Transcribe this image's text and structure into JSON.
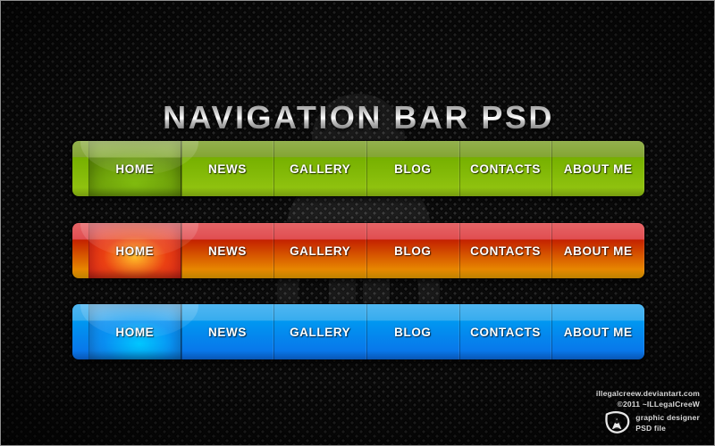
{
  "page": {
    "title": "NAVIGATION BAR PSD",
    "background_color": "#0d0d0d",
    "border_color": "#8e8e8e"
  },
  "navbars": [
    {
      "id": "green",
      "theme_name": "green",
      "accent_top": "#7fa22c",
      "accent_mid": "#76b000",
      "accent_bottom": "#96c713",
      "items": [
        {
          "label": "HOME",
          "state": "active"
        },
        {
          "label": "NEWS",
          "state": "default"
        },
        {
          "label": "GALLERY",
          "state": "default"
        },
        {
          "label": "BLOG",
          "state": "default"
        },
        {
          "label": "CONTACTS",
          "state": "default"
        },
        {
          "label": "ABOUT ME",
          "state": "default"
        }
      ]
    },
    {
      "id": "orange",
      "theme_name": "orange-red",
      "accent_top": "#e0474a",
      "accent_mid": "#c42200",
      "accent_bottom": "#f2a500",
      "items": [
        {
          "label": "HOME",
          "state": "active"
        },
        {
          "label": "NEWS",
          "state": "default"
        },
        {
          "label": "GALLERY",
          "state": "default"
        },
        {
          "label": "BLOG",
          "state": "default"
        },
        {
          "label": "CONTACTS",
          "state": "default"
        },
        {
          "label": "ABOUT ME",
          "state": "default"
        }
      ]
    },
    {
      "id": "blue",
      "theme_name": "blue",
      "accent_top": "#2fa9ee",
      "accent_mid": "#0097f1",
      "accent_bottom": "#0b6ee8",
      "items": [
        {
          "label": "HOME",
          "state": "active"
        },
        {
          "label": "NEWS",
          "state": "default"
        },
        {
          "label": "GALLERY",
          "state": "default"
        },
        {
          "label": "BLOG",
          "state": "default"
        },
        {
          "label": "CONTACTS",
          "state": "default"
        },
        {
          "label": "ABOUT ME",
          "state": "default"
        }
      ]
    }
  ],
  "credits": {
    "website": "illegalcreew.deviantart.com",
    "copyright": "©2011 ~ILLegalCreeW",
    "role": "graphic designer",
    "file_type": "PSD file",
    "logo_icon": "illegalcreew-logo-icon"
  }
}
